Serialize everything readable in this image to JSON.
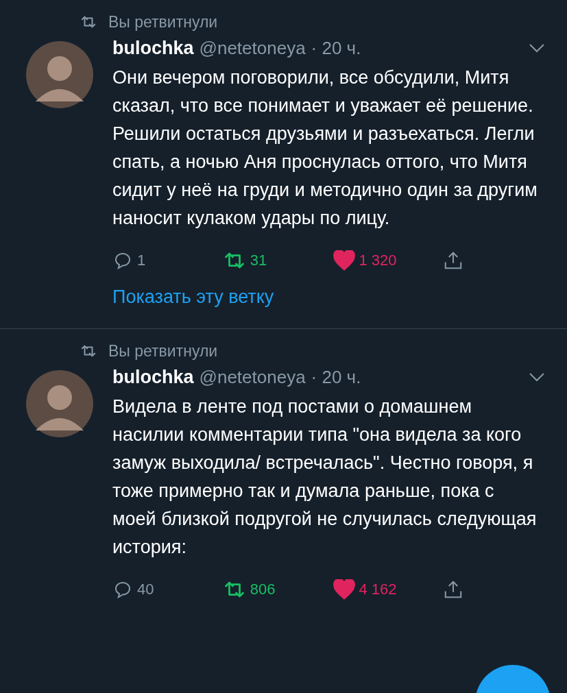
{
  "tweets": [
    {
      "retweet_label": "Вы ретвитнули",
      "author": "bulochka",
      "handle": "@netetoneya",
      "time": "· 20 ч.",
      "text": "Они вечером поговорили, все обсудили, Митя сказал, что все понимает и уважает её решение. Решили остаться друзьями и разъехаться. Легли спать, а ночью Аня проснулась оттого, что Митя сидит у неё на груди и методично один за другим наносит кулаком удары по лицу.",
      "replies": "1",
      "retweets": "31",
      "retweeted": true,
      "likes": "1 320",
      "liked": true,
      "thread_link": "Показать эту ветку"
    },
    {
      "retweet_label": "Вы ретвитнули",
      "author": "bulochka",
      "handle": "@netetoneya",
      "time": "· 20 ч.",
      "text": "Видела в ленте под постами о домашнем насилии комментарии типа \"она видела за кого замуж выходила/ встречалась\". Честно говоря, я тоже примерно так и думала раньше, пока с моей близкой подругой не случилась следующая история:",
      "replies": "40",
      "retweets": "806",
      "retweeted": true,
      "likes": "4 162",
      "liked": true
    }
  ]
}
